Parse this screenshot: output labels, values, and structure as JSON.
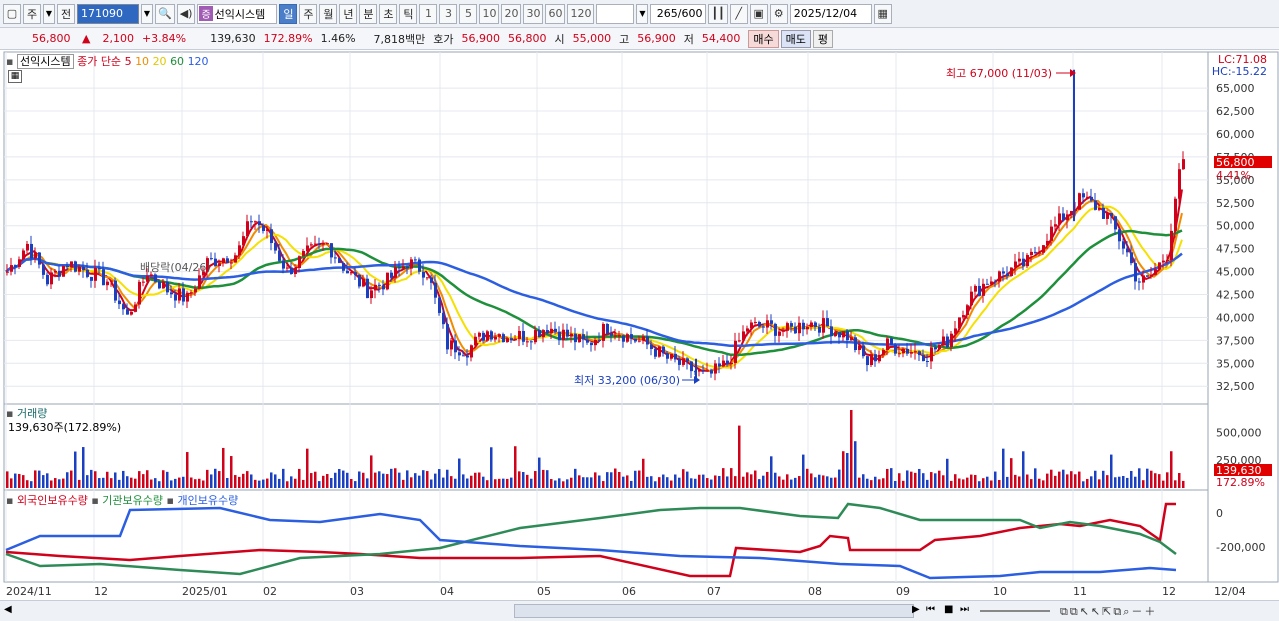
{
  "toolbar": {
    "market": "주",
    "prev": "전",
    "code": "171090",
    "stock_badge": "증",
    "stock_name": "선익시스템",
    "periods": [
      "일",
      "주",
      "월",
      "년",
      "분",
      "초",
      "틱"
    ],
    "active_period": "일",
    "intervals": [
      "1",
      "3",
      "5",
      "10",
      "20",
      "30",
      "60",
      "120"
    ],
    "count": "265",
    "count_total": "/600",
    "date": "2025/12/04"
  },
  "quote": {
    "price": "56,800",
    "arrow": "▲",
    "change": "2,100",
    "change_pct": "+3.84%",
    "volume": "139,630",
    "volume_ratio": "172.89%",
    "turnover": "1.46%",
    "amount": "7,818백만",
    "ask_label": "호가",
    "ask": "56,900",
    "bid": "56,800",
    "open_label": "시",
    "open": "55,000",
    "high_label": "고",
    "high": "56,900",
    "low_label": "저",
    "low": "54,400",
    "buy_label": "매수",
    "sell_label": "매도",
    "eval_label": "평"
  },
  "price_panel": {
    "stock_label": "선익시스템",
    "ma_label": "종가 단순",
    "ma_periods": [
      "5",
      "10",
      "20",
      "60",
      "120"
    ],
    "ma_colors": [
      "#d0021b",
      "#f08c00",
      "#f5e000",
      "#1e8f3a",
      "#2b5ee0"
    ],
    "lc": "LC:71.08",
    "hc": "HC:-15.22",
    "max_marker": "최고 67,000 (11/03)",
    "min_marker": "최저 33,200 (06/30)",
    "price_tag": "56,800",
    "pct_tag": "4.41%",
    "y_ticks": [
      "65,000",
      "62,500",
      "60,000",
      "57,500",
      "55,000",
      "52,500",
      "50,000",
      "47,500",
      "45,000",
      "42,500",
      "40,000",
      "37,500",
      "35,000",
      "32,500"
    ],
    "overlay_text": "배당락(04/26)"
  },
  "volume_panel": {
    "title": "거래량",
    "value": "139,630주(172.89%)",
    "y_ticks": [
      "500,000",
      "250,000"
    ],
    "tag_value": "139,630",
    "tag_pct": "172.89%"
  },
  "holdings_panel": {
    "labels": [
      "외국인보유수량",
      "기관보유수량",
      "개인보유수량"
    ],
    "y_ticks": [
      "0",
      "-200,000"
    ]
  },
  "x_axis": [
    "2024/11",
    "12",
    "2025/01",
    "02",
    "03",
    "04",
    "05",
    "06",
    "07",
    "08",
    "09",
    "10",
    "11",
    "12",
    "12/04"
  ],
  "chart_data": {
    "type": "line",
    "title": "",
    "series": [
      {
        "name": "종가",
        "points": [
          [
            0,
            45000
          ],
          [
            20,
            48000
          ],
          [
            40,
            44000
          ],
          [
            60,
            46000
          ],
          [
            80,
            45000
          ],
          [
            100,
            44000
          ],
          [
            120,
            40000
          ],
          [
            140,
            45000
          ],
          [
            160,
            43000
          ],
          [
            180,
            42000
          ],
          [
            200,
            46000
          ],
          [
            230,
            47000
          ],
          [
            245,
            51000
          ],
          [
            260,
            49000
          ],
          [
            280,
            45000
          ],
          [
            300,
            47000
          ],
          [
            320,
            48000
          ],
          [
            340,
            45000
          ],
          [
            360,
            43000
          ],
          [
            380,
            44000
          ],
          [
            400,
            46000
          ],
          [
            420,
            45000
          ],
          [
            440,
            37000
          ],
          [
            460,
            36500
          ],
          [
            480,
            38500
          ],
          [
            500,
            38000
          ],
          [
            520,
            38000
          ],
          [
            540,
            39000
          ],
          [
            560,
            38000
          ],
          [
            580,
            37000
          ],
          [
            600,
            39000
          ],
          [
            620,
            38000
          ],
          [
            640,
            37000
          ],
          [
            660,
            35500
          ],
          [
            680,
            34500
          ],
          [
            700,
            33500
          ],
          [
            720,
            35000
          ],
          [
            740,
            39000
          ],
          [
            760,
            39000
          ],
          [
            780,
            38500
          ],
          [
            800,
            39500
          ],
          [
            820,
            39000
          ],
          [
            840,
            38000
          ],
          [
            860,
            35000
          ],
          [
            880,
            37000
          ],
          [
            900,
            36500
          ],
          [
            920,
            36000
          ],
          [
            940,
            37500
          ],
          [
            960,
            42000
          ],
          [
            980,
            44000
          ],
          [
            1000,
            45000
          ],
          [
            1020,
            46000
          ],
          [
            1040,
            49000
          ],
          [
            1060,
            51500
          ],
          [
            1074,
            53000
          ],
          [
            1090,
            52000
          ],
          [
            1100,
            51000
          ],
          [
            1120,
            47000
          ],
          [
            1130,
            44000
          ],
          [
            1140,
            44000
          ],
          [
            1150,
            45500
          ],
          [
            1160,
            47000
          ],
          [
            1170,
            54700
          ],
          [
            1176,
            56800
          ]
        ]
      },
      {
        "name": "5",
        "values_note": ""
      },
      {
        "name": "10"
      },
      {
        "name": "20"
      },
      {
        "name": "60"
      },
      {
        "name": "120"
      }
    ],
    "y_range": [
      32500,
      67000
    ],
    "max": {
      "value": 67000,
      "date": "11/03"
    },
    "min": {
      "value": 33200,
      "date": "06/30"
    }
  }
}
